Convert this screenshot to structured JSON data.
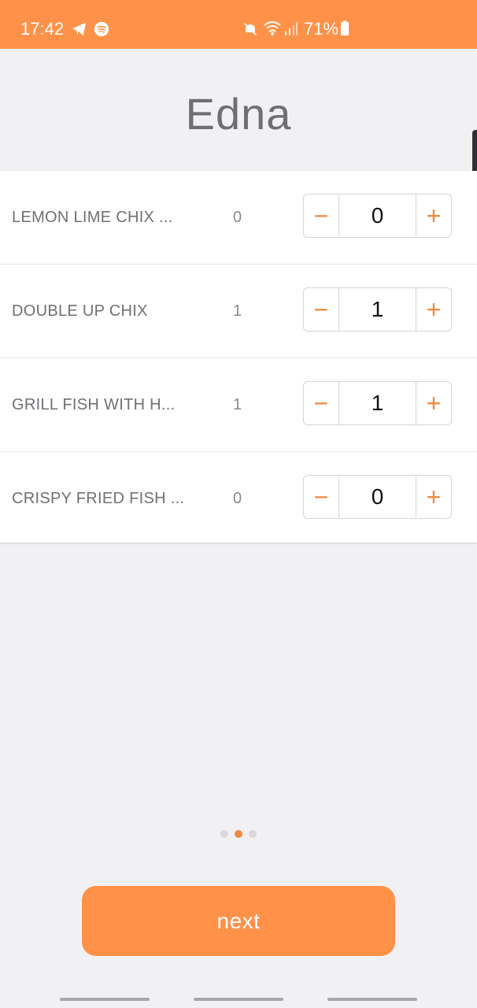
{
  "status_bar": {
    "time": "17:42",
    "battery": "71%",
    "icons": [
      "telegram-icon",
      "spotify-icon",
      "mute-icon",
      "wifi-icon",
      "signal-icon",
      "battery-icon"
    ]
  },
  "page": {
    "title": "Edna"
  },
  "items": [
    {
      "name": "LEMON LIME CHIX ...",
      "count": "0",
      "quantity": "0"
    },
    {
      "name": "DOUBLE UP CHIX",
      "count": "1",
      "quantity": "1"
    },
    {
      "name": "GRILL FISH WITH H...",
      "count": "1",
      "quantity": "1"
    },
    {
      "name": "CRISPY FRIED FISH ...",
      "count": "0",
      "quantity": "0"
    }
  ],
  "stepper": {
    "minus": "−",
    "plus": "+"
  },
  "pagination": {
    "total": 3,
    "active": 2
  },
  "actions": {
    "next_label": "next"
  },
  "colors": {
    "accent": "#ff9248",
    "background": "#f1f1f4"
  }
}
